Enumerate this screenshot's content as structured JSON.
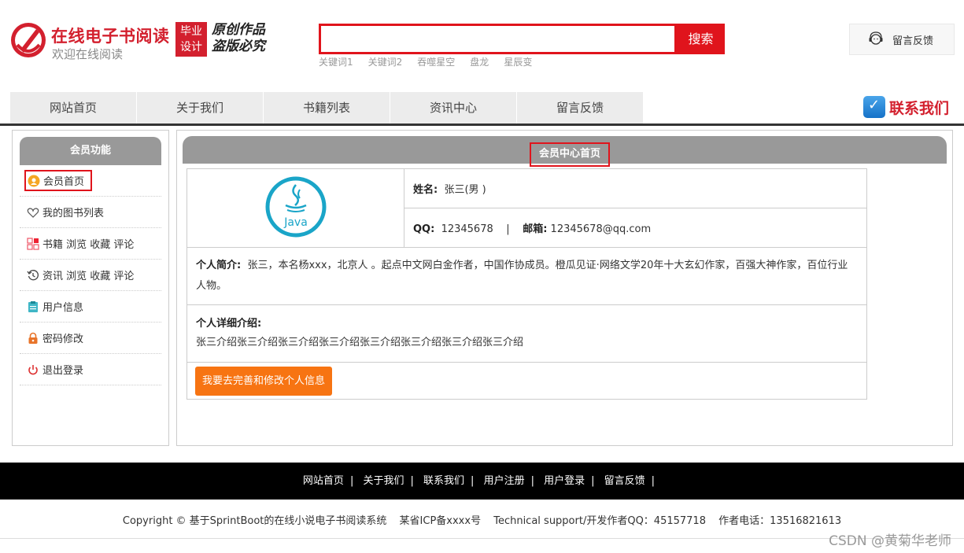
{
  "header": {
    "site_title": "在线电子书阅读",
    "site_subtitle": "欢迎在线阅读",
    "badge_line1": "毕业",
    "badge_line2": "设计",
    "slogan_line1": "原创作品",
    "slogan_line2": "盗版必究",
    "search_placeholder": "",
    "search_button": "搜索",
    "keywords": [
      "关键词1",
      "关键词2",
      "吞噬星空",
      "盘龙",
      "星辰变"
    ],
    "feedback_label": "留言反馈",
    "contact_label": "联系我们"
  },
  "nav": {
    "items": [
      "网站首页",
      "关于我们",
      "书籍列表",
      "资讯中心",
      "留言反馈"
    ]
  },
  "sidebar": {
    "title": "会员功能",
    "items": [
      {
        "label": "会员首页",
        "icon": "member-home-icon"
      },
      {
        "label": "我的图书列表",
        "icon": "book-heart-icon"
      },
      {
        "label": "书籍 浏览 收藏 评论",
        "icon": "grid-icon"
      },
      {
        "label": "资讯 浏览 收藏 评论",
        "icon": "history-icon"
      },
      {
        "label": "用户信息",
        "icon": "clipboard-icon"
      },
      {
        "label": "密码修改",
        "icon": "lock-icon"
      },
      {
        "label": "退出登录",
        "icon": "power-icon"
      }
    ]
  },
  "main": {
    "title": "会员中心首页",
    "avatar_text": "Java",
    "name_label": "姓名:",
    "name_value": "张三(男 )",
    "qq_label": "QQ:",
    "qq_value": "12345678",
    "divider": "|",
    "email_label": "邮箱:",
    "email_value": "12345678@qq.com",
    "intro_label": "个人简介:",
    "intro_value": "张三，本名杨xxx，北京人 。起点中文网白金作者，中国作协成员。橙瓜见证·网络文学20年十大玄幻作家，百强大神作家，百位行业人物。",
    "detail_label": "个人详细介绍:",
    "detail_value": "张三介绍张三介绍张三介绍张三介绍张三介绍张三介绍张三介绍张三介绍",
    "edit_button": "我要去完善和修改个人信息"
  },
  "footer": {
    "links": [
      "网站首页",
      "关于我们",
      "联系我们",
      "用户注册",
      "用户登录",
      "留言反馈"
    ],
    "separator": "|",
    "copyright": "Copyright © 基于SprintBoot的在线小说电子书阅读系统",
    "icp": "某省ICP备xxxx号",
    "support": "Technical support/开发作者QQ：45157718",
    "phone": "作者电话：13516821613"
  },
  "watermark": "CSDN @黄菊华老师",
  "colors": {
    "brand_red": "#d3202e",
    "search_red": "#e0141c",
    "orange": "#f77412",
    "header_gray": "#999999",
    "java_blue": "#1aa5c8"
  }
}
